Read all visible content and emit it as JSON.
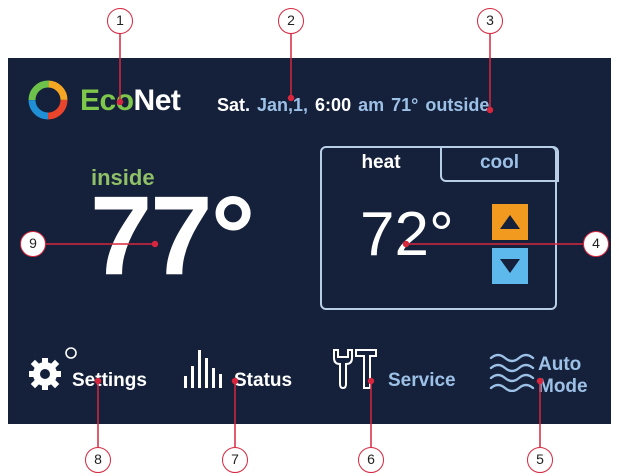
{
  "header": {
    "brand_eco": "Eco",
    "brand_net": "Net",
    "day": "Sat.",
    "date": "Jan,1,",
    "time": "6:00",
    "ampm": "am",
    "outside_temp": "71°",
    "outside_label": "outside"
  },
  "inside": {
    "label": "inside",
    "temp": "77°"
  },
  "setpoint": {
    "tab_heat": "heat",
    "tab_cool": "cool",
    "temp": "72°"
  },
  "nav": {
    "settings": "Settings",
    "status": "Status",
    "service": "Service",
    "auto": "Auto",
    "mode": "Mode"
  },
  "callouts": [
    "1",
    "2",
    "3",
    "4",
    "5",
    "6",
    "7",
    "8",
    "9"
  ],
  "colors": {
    "screen_bg": "#15203a",
    "eco_green": "#7ec74a",
    "inside_green": "#8fbf66",
    "light_blue": "#9cc0e6",
    "up_orange": "#f29a1f",
    "down_blue": "#5db8ec",
    "callout_red": "#d7263d"
  }
}
